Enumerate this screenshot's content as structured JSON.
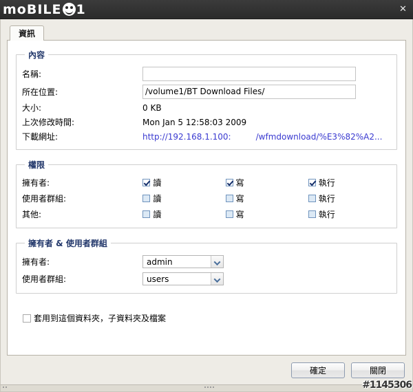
{
  "titlebar": {
    "logo_text": "moBILE",
    "logo_suffix": "1",
    "close_label": "✕"
  },
  "tabs": [
    {
      "label": "資訊",
      "active": true
    }
  ],
  "content_group": {
    "legend": "內容",
    "rows": [
      {
        "label": "名稱:",
        "type": "input",
        "value": "",
        "placeholder": ""
      },
      {
        "label": "所在位置:",
        "type": "input",
        "value": "/volume1/BT Download Files/",
        "placeholder": ""
      },
      {
        "label": "大小:",
        "type": "text",
        "value": "0 KB"
      },
      {
        "label": "上次修改時間:",
        "type": "text",
        "value": "Mon Jan 5 12:58:03 2009"
      },
      {
        "label": "下載網址:",
        "type": "url",
        "host": "http://192.168.1.100:",
        "path": "/wfmdownload/%E3%82%A2..."
      }
    ]
  },
  "permissions_group": {
    "legend": "權限",
    "column_labels": {
      "read": "讀",
      "write": "寫",
      "execute": "執行"
    },
    "rows": [
      {
        "label": "擁有者:",
        "read": true,
        "write": true,
        "execute": true
      },
      {
        "label": "使用者群組:",
        "read": false,
        "write": false,
        "execute": false
      },
      {
        "label": "其他:",
        "read": false,
        "write": false,
        "execute": false
      }
    ]
  },
  "ownership_group": {
    "legend": "擁有者 & 使用者群組",
    "rows": [
      {
        "label": "擁有者:",
        "value": "admin"
      },
      {
        "label": "使用者群組:",
        "value": "users"
      }
    ]
  },
  "apply_checkbox": {
    "label": "套用到這個資料夾，子資料夾及檔案",
    "checked": false
  },
  "footer": {
    "ok_label": "確定",
    "close_label": "關閉"
  },
  "watermark": {
    "text": "#1145306"
  },
  "colors": {
    "titlebar": "#333333",
    "dialog_bg": "#eeece6",
    "panel_bg": "#ffffff",
    "legend_text": "#23386b",
    "link_text": "#3a3ad0",
    "checkbox_border": "#6f93bd",
    "checkbox_fill": "#dce9f5",
    "check_mark": "#16306b"
  }
}
